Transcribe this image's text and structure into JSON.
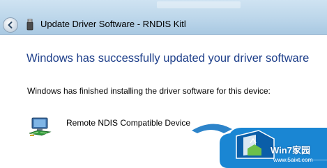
{
  "window": {
    "title": "Update Driver Software - RNDIS Kitl"
  },
  "navigation": {
    "back_icon": "back-arrow-icon",
    "title_icon": "usb-device-icon"
  },
  "content": {
    "heading": "Windows has successfully updated your driver software",
    "message": "Windows has finished installing the driver software for this device:",
    "device": {
      "name": "Remote NDIS Compatible Device",
      "icon": "network-adapter-icon"
    }
  },
  "watermark": {
    "brand": "Win7家园",
    "url": "www.5aixt.com"
  },
  "colors": {
    "heading": "#1e3f8a",
    "titlebar": "#bcd6ea"
  }
}
